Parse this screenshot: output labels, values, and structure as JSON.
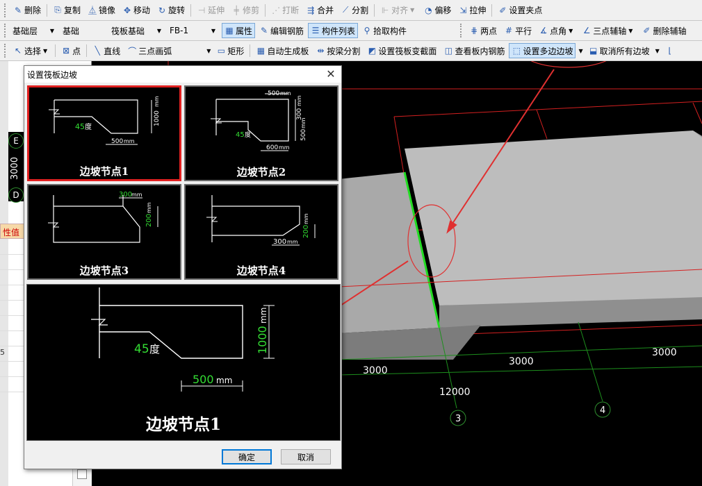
{
  "toolbar1": {
    "buttons": [
      {
        "label": "删除",
        "icon": "eraser-icon",
        "enabled": true
      },
      {
        "label": "复制",
        "icon": "copy-icon",
        "enabled": true
      },
      {
        "label": "镜像",
        "icon": "mirror-icon",
        "enabled": true
      },
      {
        "label": "移动",
        "icon": "move-icon",
        "enabled": true
      },
      {
        "label": "旋转",
        "icon": "rotate-icon",
        "enabled": true
      },
      {
        "label": "延伸",
        "icon": "extend-icon",
        "enabled": false
      },
      {
        "label": "修剪",
        "icon": "trim-icon",
        "enabled": false
      },
      {
        "label": "打断",
        "icon": "break-icon",
        "enabled": false
      },
      {
        "label": "合并",
        "icon": "merge-icon",
        "enabled": true
      },
      {
        "label": "分割",
        "icon": "split-icon",
        "enabled": true
      },
      {
        "label": "对齐",
        "icon": "align-icon",
        "enabled": false
      },
      {
        "label": "偏移",
        "icon": "offset-icon",
        "enabled": true
      },
      {
        "label": "拉伸",
        "icon": "stretch-icon",
        "enabled": true
      },
      {
        "label": "设置夹点",
        "icon": "grip-point-icon",
        "enabled": true
      }
    ]
  },
  "toolbar2": {
    "floor": "基础层",
    "category": "基础",
    "element_type": "筏板基础",
    "element_name": "FB-1",
    "buttons": [
      {
        "label": "属性",
        "icon": "properties-icon",
        "active": true
      },
      {
        "label": "编辑钢筋",
        "icon": "edit-rebar-icon",
        "active": false
      },
      {
        "label": "构件列表",
        "icon": "element-list-icon",
        "active": true
      },
      {
        "label": "拾取构件",
        "icon": "pick-icon",
        "active": false
      }
    ],
    "axis_buttons": [
      {
        "label": "两点",
        "icon": "two-point-axis-icon"
      },
      {
        "label": "平行",
        "icon": "parallel-axis-icon"
      },
      {
        "label": "点角",
        "icon": "point-angle-axis-icon"
      },
      {
        "label": "三点辅轴",
        "icon": "three-point-axis-icon"
      },
      {
        "label": "删除辅轴",
        "icon": "delete-axis-icon"
      }
    ]
  },
  "toolbar3": {
    "buttons": [
      {
        "label": "选择",
        "icon": "cursor-icon"
      },
      {
        "label": "点",
        "icon": "point-icon"
      },
      {
        "label": "直线",
        "icon": "line-icon"
      },
      {
        "label": "三点画弧",
        "icon": "arc-icon"
      },
      {
        "label": "矩形",
        "icon": "rectangle-icon"
      },
      {
        "label": "自动生成板",
        "icon": "auto-slab-icon"
      },
      {
        "label": "按梁分割",
        "icon": "split-by-beam-icon"
      },
      {
        "label": "设置筏板变截面",
        "icon": "variable-section-icon"
      },
      {
        "label": "查看板内钢筋",
        "icon": "view-rebar-icon"
      },
      {
        "label": "设置多边边坡",
        "icon": "multi-slope-icon"
      },
      {
        "label": "取消所有边坡",
        "icon": "cancel-slope-icon"
      }
    ]
  },
  "left_panel": {
    "axis_e": "E",
    "axis_d": "D",
    "dimension": "3000",
    "property_header": "性值",
    "row_text": "5"
  },
  "viewport": {
    "dims": [
      "3000",
      "3000",
      "3000",
      "12000"
    ],
    "axes": [
      "3",
      "4"
    ]
  },
  "dialog": {
    "title": "设置筏板边坡",
    "close_label": "✕",
    "tiles": [
      {
        "label": "边坡节点1",
        "selected": true,
        "angle_num": "45",
        "angle_unit": "度",
        "height_num": "1000",
        "height_unit": "mm",
        "width_num": "500",
        "width_unit": "mm"
      },
      {
        "label": "边坡节点2",
        "selected": false,
        "top_num": "500",
        "top_unit": "mm",
        "step_num": "300",
        "step_unit": "mm",
        "height_num": "500",
        "height_unit": "mm",
        "angle_num": "45",
        "angle_unit": "度",
        "width_num": "600",
        "width_unit": "mm"
      },
      {
        "label": "边坡节点3",
        "selected": false,
        "width_num": "300",
        "width_unit": "mm",
        "height_num": "200",
        "height_unit": "mm"
      },
      {
        "label": "边坡节点4",
        "selected": false,
        "width_num": "300",
        "width_unit": "mm",
        "height_num": "200",
        "height_unit": "mm"
      }
    ],
    "preview": {
      "label": "边坡节点1",
      "angle_num": "45",
      "angle_unit": "度",
      "height_num": "1000",
      "height_unit": "mm",
      "width_num": "500",
      "width_unit": "mm"
    },
    "ok_label": "确定",
    "cancel_label": "取消"
  },
  "colors": {
    "annotation": "#e03030",
    "dimension_green": "#33dd33",
    "slab_fill": "#bdbdbd",
    "selected_tile_border": "#e02020"
  }
}
